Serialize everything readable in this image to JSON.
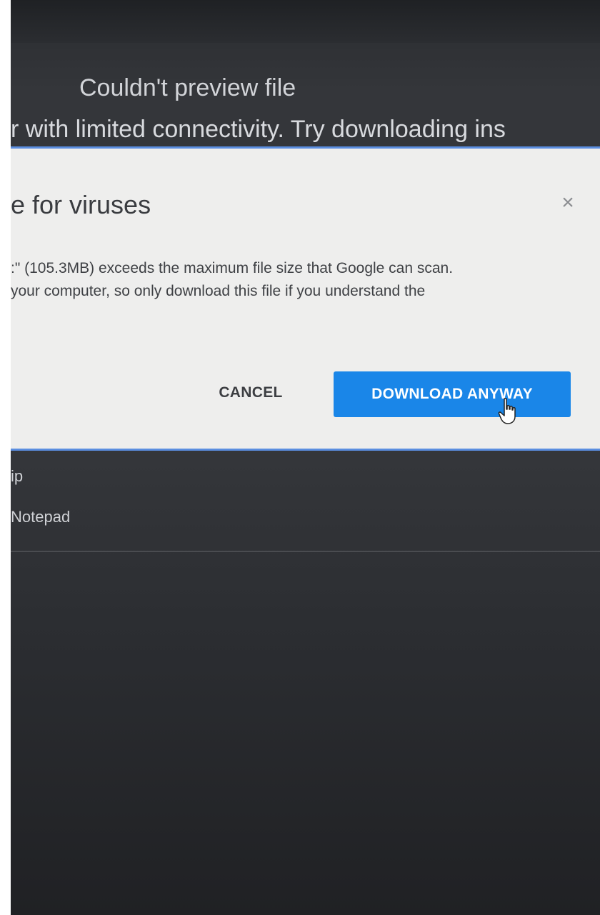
{
  "preview": {
    "title": "Couldn't preview file",
    "message": "r with limited connectivity. Try downloading ins"
  },
  "dialog": {
    "title": "e for viruses",
    "close_glyph": "×",
    "body_line_1": ":\" (105.3MB) exceeds the maximum file size that Google can scan.",
    "body_line_2": "your computer, so only download this file if you understand the",
    "cancel_label": "CANCEL",
    "download_label": "DOWNLOAD ANYWAY",
    "accent_color": "#1a86e8"
  },
  "list": {
    "items": [
      "ip",
      "Notepad"
    ]
  },
  "icons": {
    "close": "close-icon",
    "cursor": "hand-pointer-icon"
  }
}
